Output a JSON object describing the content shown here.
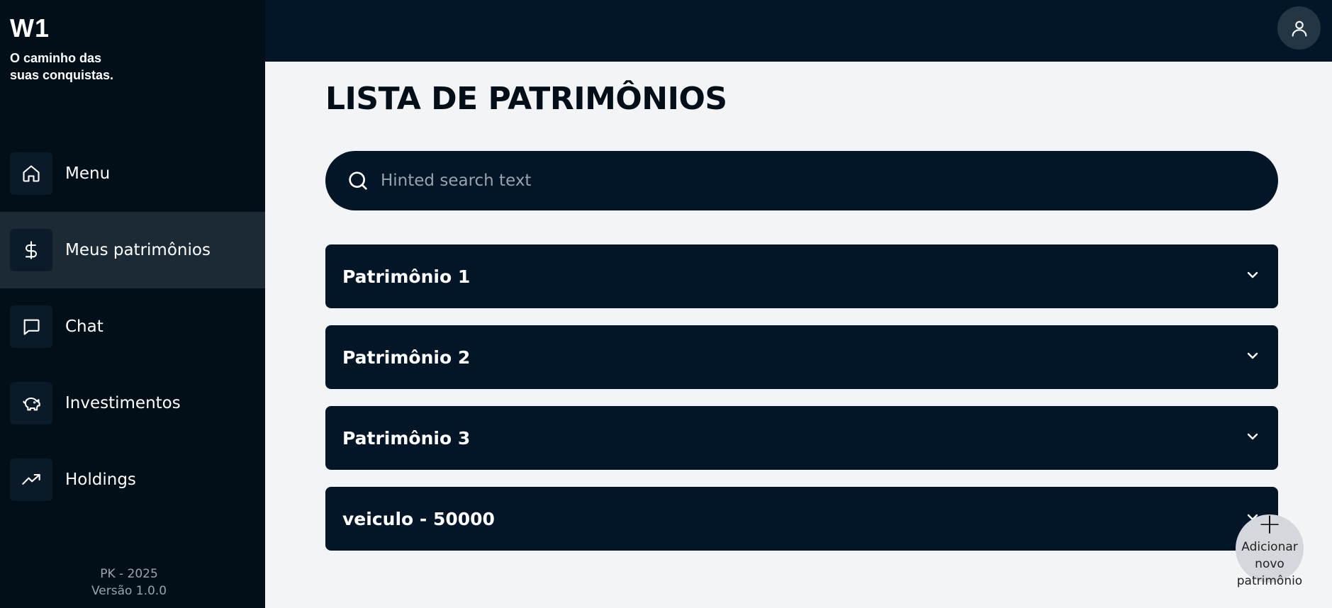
{
  "brand": {
    "title": "W1",
    "tagline": "O caminho das suas conquistas."
  },
  "sidebar": {
    "items": [
      {
        "label": "Menu",
        "icon": "home-icon"
      },
      {
        "label": "Meus patrimônios",
        "icon": "dollar-icon",
        "active": true
      },
      {
        "label": "Chat",
        "icon": "chat-icon"
      },
      {
        "label": "Investimentos",
        "icon": "piggy-bank-icon"
      },
      {
        "label": "Holdings",
        "icon": "trending-up-icon"
      }
    ],
    "footer": {
      "company": "PK - 2025",
      "version": "Versão 1.0.0"
    }
  },
  "topbar": {
    "avatar_icon": "user-icon"
  },
  "main": {
    "title": "LISTA DE PATRIMÔNIOS",
    "search": {
      "placeholder": "Hinted search text",
      "value": ""
    },
    "assets": [
      {
        "name": "Patrimônio 1"
      },
      {
        "name": "Patrimônio 2"
      },
      {
        "name": "Patrimônio 3"
      },
      {
        "name": "veiculo - 50000"
      }
    ],
    "fab": {
      "icon": "plus-icon",
      "label": "Adicionar novo patrimônio"
    }
  },
  "colors": {
    "sidebar_bg": "#020f19",
    "primary_dark": "#021627",
    "active_item": "#1c2a35",
    "page_bg": "#f3f4f6"
  }
}
